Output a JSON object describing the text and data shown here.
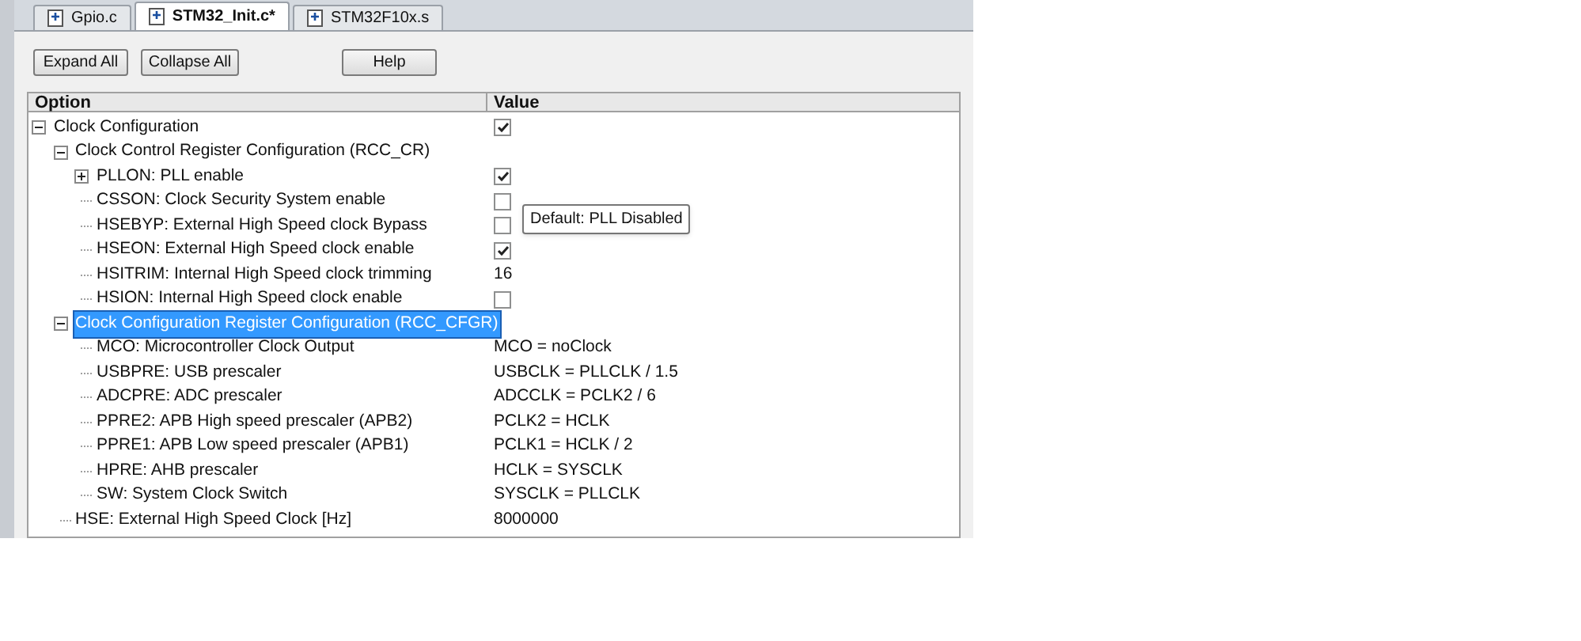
{
  "tabs": [
    {
      "label": "Gpio.c",
      "selected": false
    },
    {
      "label": "STM32_Init.c*",
      "selected": true
    },
    {
      "label": "STM32F10x.s",
      "selected": false
    }
  ],
  "buttons": [
    "Expand All",
    "Collapse All",
    "Help"
  ],
  "table": {
    "columns": [
      "Option",
      "Value"
    ],
    "rows": [
      {
        "option": "Clock Configuration",
        "kind": "checkbox",
        "checked": true,
        "expanded": true,
        "selected": false,
        "children": [
          {
            "option": "Clock Control Register Configuration (RCC_CR)",
            "kind": "none",
            "expanded": true,
            "selected": false,
            "children": [
              {
                "option": "PLLON: PLL enable",
                "kind": "checkbox",
                "checked": true,
                "expanded": false,
                "selected": false
              },
              {
                "option": "CSSON: Clock Security System enable",
                "kind": "checkbox",
                "checked": false,
                "selected": false
              },
              {
                "option": "HSEBYP: External High Speed clock Bypass",
                "kind": "checkbox",
                "checked": false,
                "selected": false
              },
              {
                "option": "HSEON: External High Speed clock enable",
                "kind": "checkbox",
                "checked": true,
                "selected": false
              },
              {
                "option": "HSITRIM: Internal High Speed clock trimming",
                "kind": "text",
                "value": "16",
                "selected": false
              },
              {
                "option": "HSION: Internal High Speed clock enable",
                "kind": "checkbox",
                "checked": false,
                "selected": false
              }
            ]
          },
          {
            "option": "Clock Configuration Register Configuration (RCC_CFGR)",
            "kind": "none",
            "expanded": true,
            "selected": true,
            "children": [
              {
                "option": "MCO: Microcontroller Clock Output",
                "kind": "text",
                "value": "MCO = noClock",
                "selected": false
              },
              {
                "option": "USBPRE: USB prescaler",
                "kind": "text",
                "value": "USBCLK = PLLCLK / 1.5",
                "selected": false
              },
              {
                "option": "ADCPRE: ADC prescaler",
                "kind": "text",
                "value": "ADCCLK = PCLK2 / 6",
                "selected": false
              },
              {
                "option": "PPRE2: APB High speed prescaler (APB2)",
                "kind": "text",
                "value": "PCLK2 = HCLK",
                "selected": false
              },
              {
                "option": "PPRE1: APB Low speed prescaler (APB1)",
                "kind": "text",
                "value": "PCLK1 = HCLK / 2",
                "selected": false
              },
              {
                "option": "HPRE: AHB prescaler",
                "kind": "text",
                "value": "HCLK = SYSCLK",
                "selected": false
              },
              {
                "option": "SW: System Clock Switch",
                "kind": "text",
                "value": "SYSCLK = PLLCLK",
                "selected": false
              }
            ]
          },
          {
            "option": "HSE: External High Speed Clock [Hz]",
            "kind": "text",
            "value": "8000000",
            "selected": false
          }
        ]
      }
    ]
  },
  "tooltip": "Default: PLL Disabled"
}
